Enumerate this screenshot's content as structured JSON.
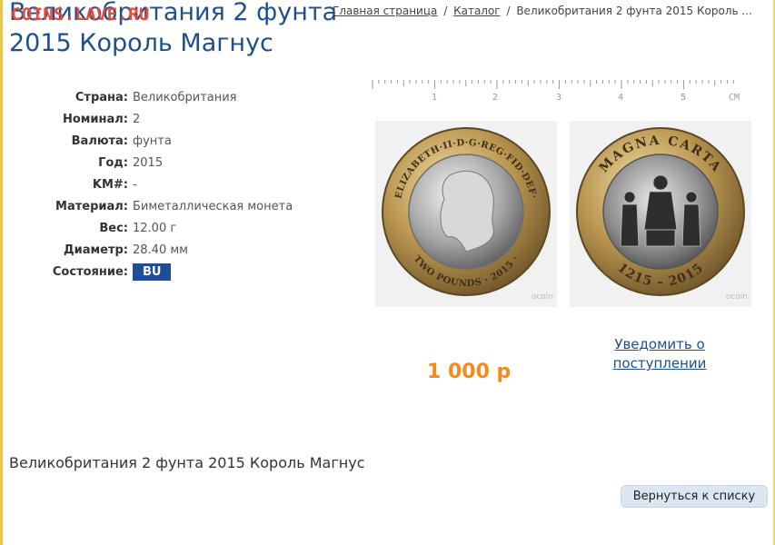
{
  "page": {
    "title": "Великобритания 2 фунта 2015 Король Магнус",
    "watermark": "COINS.LAVE.RU"
  },
  "breadcrumb": {
    "home": "Главная страница",
    "catalog": "Каталог",
    "separator": "/",
    "current": "Великобритания 2 фунта 2015 Король ..."
  },
  "specs": [
    {
      "label": "Страна:",
      "value": "Великобритания"
    },
    {
      "label": "Номинал:",
      "value": "2"
    },
    {
      "label": "Валюта:",
      "value": "фунта"
    },
    {
      "label": "Год:",
      "value": "2015"
    },
    {
      "label": "KM#:",
      "value": "-"
    },
    {
      "label": "Материал:",
      "value": "Биметаллическая монета"
    },
    {
      "label": "Вес:",
      "value": "12.00 г"
    },
    {
      "label": "Диаметр:",
      "value": "28.40 мм"
    }
  ],
  "condition": {
    "label": "Состояние:",
    "value": "BU"
  },
  "ruler": {
    "ticks": [
      "1",
      "2",
      "3",
      "4",
      "5"
    ],
    "unit": "СМ"
  },
  "coins": {
    "obverse": {
      "legend": "ELIZABETH·II·D·G·REG·FID·DEF·",
      "bottom": "TWO POUNDS · 2015 ·",
      "credit": "ocoin"
    },
    "reverse": {
      "legend": "MAGNA CARTA",
      "bottom": "1215 – 2015",
      "credit": "ocoin"
    }
  },
  "price": "1 000 р",
  "notify_link": "Уведомить о поступлении",
  "description": "Великобритания 2 фунта 2015 Король Магнус",
  "back_button": "Вернуться к списку",
  "colors": {
    "title": "#1f4f8b",
    "watermark": "#e74c3c",
    "price": "#f38b1c",
    "badge_bg": "#1e4f94",
    "button_bg": "#dbe6f2"
  },
  "icons": {
    "ruler": "ruler-icon"
  }
}
